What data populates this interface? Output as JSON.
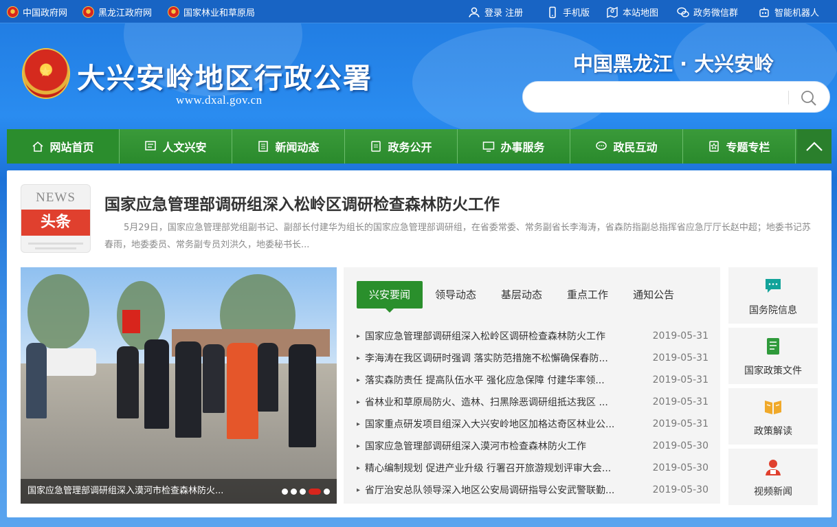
{
  "topbar": {
    "links": [
      {
        "label": "中国政府网",
        "icon": "national-emblem-icon"
      },
      {
        "label": "黑龙江政府网",
        "icon": "national-emblem-icon"
      },
      {
        "label": "国家林业和草原局",
        "icon": "national-emblem-icon"
      }
    ],
    "right": [
      {
        "label": "登录 注册",
        "icon": "user-icon"
      },
      {
        "label": "手机版",
        "icon": "mobile-icon"
      },
      {
        "label": "本站地图",
        "icon": "map-icon"
      },
      {
        "label": "政务微信群",
        "icon": "wechat-icon"
      },
      {
        "label": "智能机器人",
        "icon": "robot-icon"
      }
    ]
  },
  "header": {
    "title": "大兴安岭地区行政公署",
    "url": "www.dxal.gov.cn",
    "slogan": "中国黑龙江 · 大兴安岭",
    "search_placeholder": ""
  },
  "nav": {
    "items": [
      {
        "label": "网站首页",
        "icon": "home-icon"
      },
      {
        "label": "人文兴安",
        "icon": "monitor-icon"
      },
      {
        "label": "新闻动态",
        "icon": "document-icon"
      },
      {
        "label": "政务公开",
        "icon": "clipboard-icon"
      },
      {
        "label": "办事服务",
        "icon": "screen-icon"
      },
      {
        "label": "政民互动",
        "icon": "chat-icon"
      },
      {
        "label": "专题专栏",
        "icon": "star-book-icon"
      }
    ]
  },
  "headline": {
    "badge_en": "NEWS",
    "badge_cn": "头条",
    "title": "国家应急管理部调研组深入松岭区调研检查森林防火工作",
    "summary": "5月29日，国家应急管理部党组副书记、副部长付建华为组长的国家应急管理部调研组，在省委常委、常务副省长李海涛，省森防指副总指挥省应急厅厅长赵中超；地委书记苏春雨，地委委员、常务副专员刘洪久，地委秘书长..."
  },
  "carousel": {
    "caption": "国家应急管理部调研组深入漠河市检查森林防火...",
    "slide_count": 5,
    "active_slide": 4
  },
  "news": {
    "tabs": [
      "兴安要闻",
      "领导动态",
      "基层动态",
      "重点工作",
      "通知公告"
    ],
    "active_tab": 0,
    "items": [
      {
        "title": "国家应急管理部调研组深入松岭区调研检查森林防火工作",
        "date": "2019-05-31"
      },
      {
        "title": "李海涛在我区调研时强调 落实防范措施不松懈确保春防...",
        "date": "2019-05-31"
      },
      {
        "title": "落实森防责任 提高队伍水平 强化应急保障 付建华率领...",
        "date": "2019-05-31"
      },
      {
        "title": "省林业和草原局防火、造林、扫黑除恶调研组抵达我区 ...",
        "date": "2019-05-31"
      },
      {
        "title": "国家重点研发项目组深入大兴安岭地区加格达奇区林业公...",
        "date": "2019-05-31"
      },
      {
        "title": "国家应急管理部调研组深入漠河市检查森林防火工作",
        "date": "2019-05-30"
      },
      {
        "title": "精心编制规划 促进产业升级 行署召开旅游规划评审大会...",
        "date": "2019-05-30"
      },
      {
        "title": "省厅治安总队领导深入地区公安局调研指导公安武警联勤...",
        "date": "2019-05-30"
      }
    ]
  },
  "side": [
    {
      "label": "国务院信息",
      "icon": "chat-bubble-icon",
      "color": "#12a39a"
    },
    {
      "label": "国家政策文件",
      "icon": "document-green-icon",
      "color": "#2f9a3b"
    },
    {
      "label": "政策解读",
      "icon": "open-book-icon",
      "color": "#f0a92a"
    },
    {
      "label": "视频新闻",
      "icon": "presenter-icon",
      "color": "#e0402e"
    }
  ],
  "colors": {
    "nav_green": "#2a8a2c",
    "accent_red": "#e0402e",
    "header_blue": "#1f7ae0"
  }
}
